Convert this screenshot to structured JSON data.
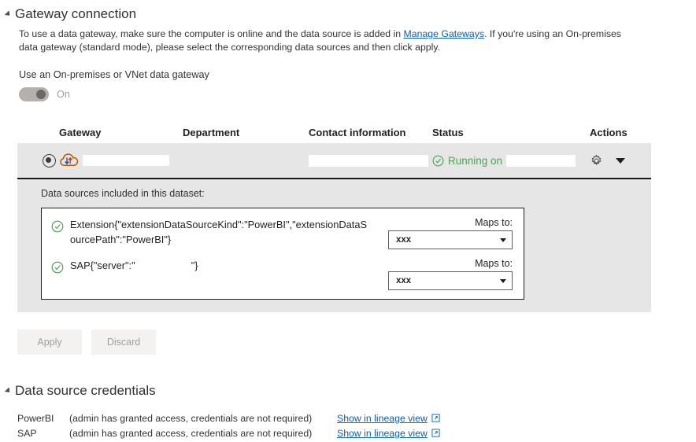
{
  "gateway_section": {
    "title": "Gateway connection",
    "collapse_icon": "triangle-collapse-icon",
    "description_part1": "To use a data gateway, make sure the computer is online and the data source is added in ",
    "description_link": "Manage Gateways",
    "description_part2": ". If you're using an On-premises data gateway (standard mode), please select the corresponding data sources and then click apply.",
    "toggle_label": "Use an On-premises or VNet data gateway",
    "toggle_state_text": "On",
    "toggle_on": true
  },
  "table": {
    "columns": [
      "Gateway",
      "Department",
      "Contact information",
      "Status",
      "Actions"
    ],
    "rows": [
      {
        "selected": true,
        "gateway_icon": "cloud-gateway-icon",
        "gateway_name": "",
        "gateway_redacted": true,
        "department": "",
        "contact_information": "",
        "contact_redacted": true,
        "status_icon": "check-circle-icon",
        "status_text": "Running on",
        "status_suffix_redacted": true,
        "actions": {
          "settings_icon": "gear-icon",
          "expand_icon": "caret-down-icon"
        }
      }
    ]
  },
  "data_sources_panel": {
    "title": "Data sources included in this dataset:",
    "items": [
      {
        "status_icon": "check-circle-icon",
        "name": "Extension{\"extensionDataSourceKind\":\"PowerBI\",\"extensionDataSourcePath\":\"PowerBI\"}",
        "maps_to_label": "Maps to:",
        "maps_to_value": "xxx",
        "dropdown_icon": "chevron-down-icon"
      },
      {
        "status_icon": "check-circle-icon",
        "name": "SAP{\"server\":\"                    \"}",
        "maps_to_label": "Maps to:",
        "maps_to_value": "xxx",
        "dropdown_icon": "chevron-down-icon"
      }
    ]
  },
  "buttons": {
    "apply": "Apply",
    "discard": "Discard"
  },
  "credentials_section": {
    "title": "Data source credentials",
    "collapse_icon": "triangle-collapse-icon",
    "rows": [
      {
        "name": "PowerBI",
        "note": "(admin has granted access, credentials are not required)",
        "link": "Show in lineage view",
        "link_icon": "external-link-icon"
      },
      {
        "name": "SAP",
        "note": "(admin has granted access, credentials are not required)",
        "link": "Show in lineage view",
        "link_icon": "external-link-icon"
      }
    ]
  },
  "colors": {
    "accent_link": "#0a5fad",
    "status_green": "#4fa053",
    "panel_gray": "#e6e6e6",
    "disabled_text": "#a19f9d"
  }
}
